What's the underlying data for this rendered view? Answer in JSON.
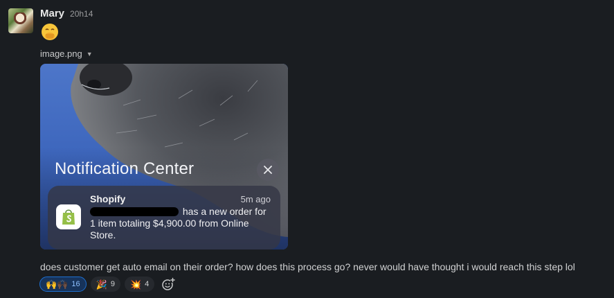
{
  "message": {
    "author": "Mary",
    "timestamp": "20h14",
    "emoji": "🤭",
    "text": "does customer get auto email on their order? how does this process go? never would have thought i would reach this step lol"
  },
  "attachment": {
    "filename": "image.png",
    "notification_center_title": "Notification Center",
    "notification": {
      "app_name": "Shopify",
      "time": "5m ago",
      "body_after_redaction": "has a new order for 1 item totaling $4,900.00 from Online Store."
    }
  },
  "reactions": [
    {
      "emoji": "🙌🙌🏿",
      "count": "16",
      "active": true
    },
    {
      "emoji": "🎉",
      "count": "9",
      "active": false
    },
    {
      "emoji": "💥",
      "count": "4",
      "active": false
    }
  ],
  "icons": {
    "add_reaction": "add-reaction-icon",
    "close": "close-icon",
    "dropdown": "chevron-down-icon",
    "shopify": "shopify-bag-icon"
  }
}
